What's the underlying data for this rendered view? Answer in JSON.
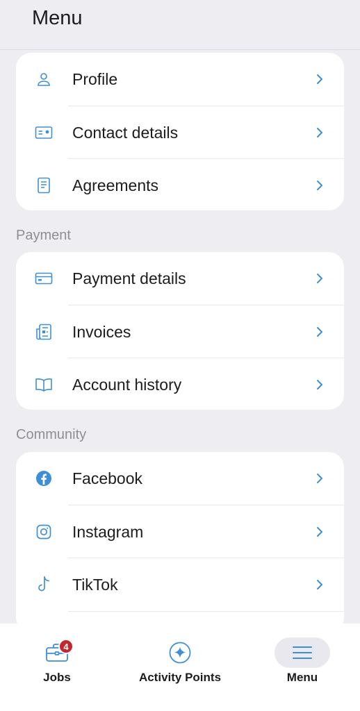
{
  "header": {
    "title": "Menu"
  },
  "groups": [
    {
      "title": "",
      "items": [
        {
          "label": "Profile",
          "icon": "person-icon"
        },
        {
          "label": "Contact details",
          "icon": "id-card-icon"
        },
        {
          "label": "Agreements",
          "icon": "document-icon"
        }
      ]
    },
    {
      "title": "Payment",
      "items": [
        {
          "label": "Payment details",
          "icon": "credit-card-icon"
        },
        {
          "label": "Invoices",
          "icon": "invoice-icon"
        },
        {
          "label": "Account history",
          "icon": "book-icon"
        }
      ]
    },
    {
      "title": "Community",
      "items": [
        {
          "label": "Facebook",
          "icon": "facebook-icon"
        },
        {
          "label": "Instagram",
          "icon": "instagram-icon"
        },
        {
          "label": "TikTok",
          "icon": "tiktok-icon"
        }
      ]
    }
  ],
  "bottom_nav": {
    "items": [
      {
        "label": "Jobs",
        "icon": "briefcase-icon",
        "badge": "4"
      },
      {
        "label": "Activity Points",
        "icon": "sparkle-icon"
      },
      {
        "label": "Menu",
        "icon": "hamburger-icon",
        "active": true
      }
    ]
  },
  "colors": {
    "accent": "#3d8fd6",
    "background": "#eeedf2",
    "card": "#ffffff",
    "badge": "#c0282d",
    "section_title": "#8e8e93"
  }
}
